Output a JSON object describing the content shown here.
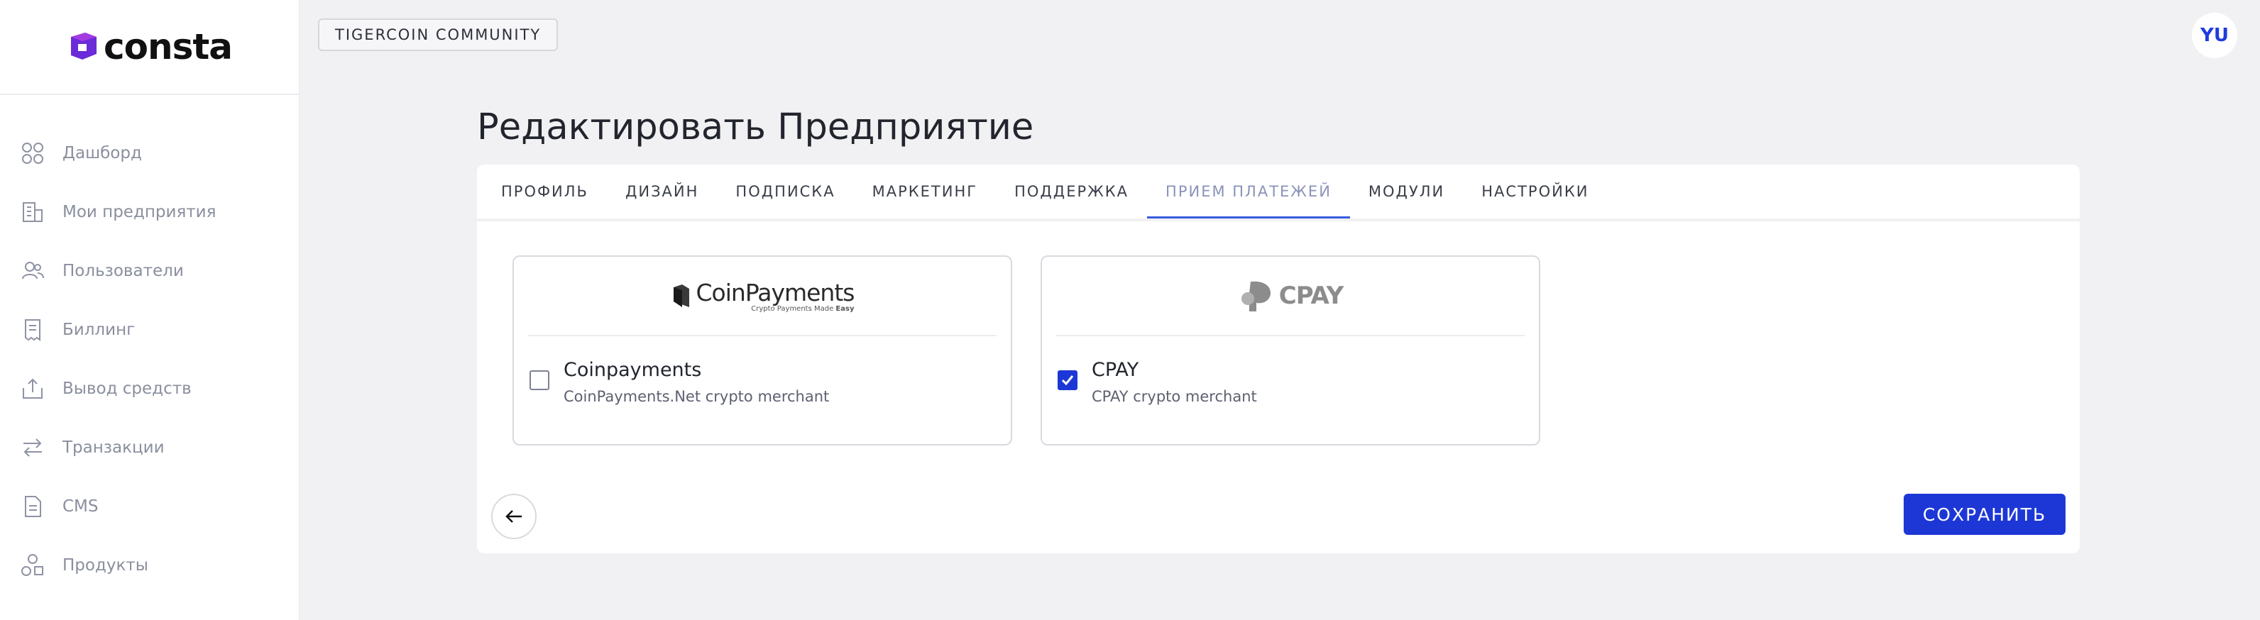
{
  "app": {
    "logo_text": "consta"
  },
  "sidebar": {
    "items": [
      {
        "label": "Дашборд",
        "icon": "grid-icon"
      },
      {
        "label": "Мои предприятия",
        "icon": "building-icon"
      },
      {
        "label": "Пользователи",
        "icon": "users-icon"
      },
      {
        "label": "Биллинг",
        "icon": "receipt-icon"
      },
      {
        "label": "Вывод средств",
        "icon": "upload-icon"
      },
      {
        "label": "Транзакции",
        "icon": "arrows-swap-icon"
      },
      {
        "label": "CMS",
        "icon": "document-icon"
      },
      {
        "label": "Продукты",
        "icon": "shapes-icon"
      }
    ]
  },
  "header": {
    "community": "TIGERCOIN COMMUNITY",
    "avatar_initials": "YU"
  },
  "main": {
    "title": "Редактировать Предприятие",
    "tabs": [
      {
        "label": "ПРОФИЛЬ",
        "active": false
      },
      {
        "label": "ДИЗАЙН",
        "active": false
      },
      {
        "label": "ПОДПИСКА",
        "active": false
      },
      {
        "label": "МАРКЕТИНГ",
        "active": false
      },
      {
        "label": "ПОДДЕРЖКА",
        "active": false
      },
      {
        "label": "ПРИЕМ ПЛАТЕЖЕЙ",
        "active": true
      },
      {
        "label": "МОДУЛИ",
        "active": false
      },
      {
        "label": "НАСТРОЙКИ",
        "active": false
      }
    ],
    "payment_methods": [
      {
        "logo_main": "CoinPayments",
        "logo_sub_prefix": "Crypto Payments Made ",
        "logo_sub_emph": "Easy",
        "title": "Coinpayments",
        "description": "CoinPayments.Net crypto merchant",
        "checked": false
      },
      {
        "logo_main": "CPAY",
        "title": "CPAY",
        "description": "CPAY crypto merchant",
        "checked": true
      }
    ],
    "save_label": "СОХРАНИТЬ"
  },
  "colors": {
    "accent": "#1d37d6",
    "active_tab_underline": "#3a5be0",
    "logo_purple": "#6b2bd9"
  }
}
